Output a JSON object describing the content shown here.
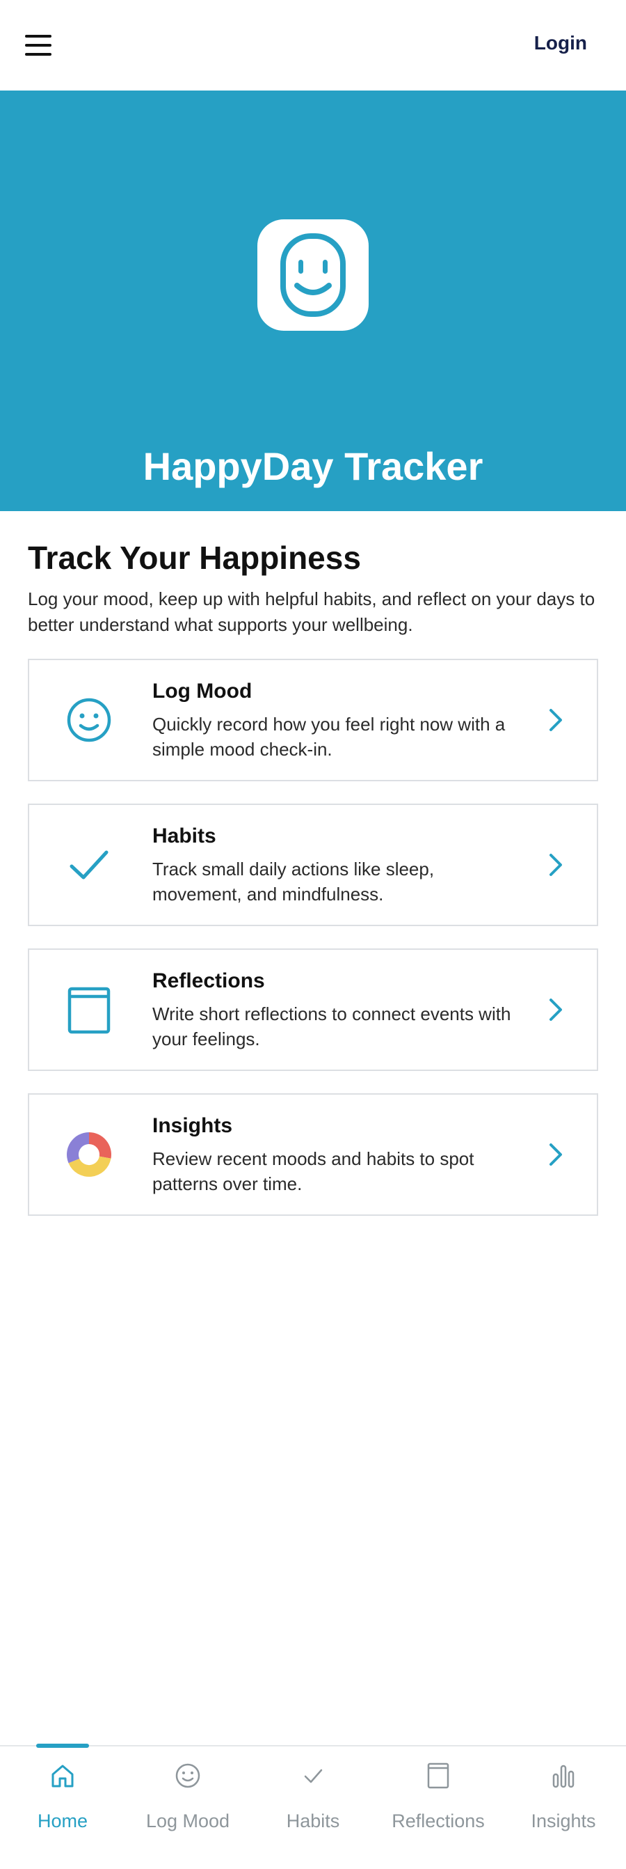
{
  "header": {
    "login_label": "Login"
  },
  "hero": {
    "title": "HappyDay Tracker",
    "background_color": "#26a0c4",
    "icon": "smile-face-icon"
  },
  "intro": {
    "title": "Track Your Happiness",
    "description": "Log your mood, keep up with helpful habits, and reflect on your days to better understand what supports your wellbeing."
  },
  "cards": [
    {
      "title": "Log Mood",
      "description": "Quickly record how you feel right now with a simple mood check-in.",
      "icon": "smile-icon"
    },
    {
      "title": "Habits",
      "description": "Track small daily actions like sleep, movement, and mindfulness.",
      "icon": "checkmark-icon"
    },
    {
      "title": "Reflections",
      "description": "Write short reflections to connect events with your feelings.",
      "icon": "journal-icon"
    },
    {
      "title": "Insights",
      "description": "Review recent moods and habits to spot patterns over time.",
      "icon": "donut-chart-icon"
    }
  ],
  "bottom_nav": {
    "items": [
      {
        "label": "Home",
        "icon": "home-icon",
        "active": true
      },
      {
        "label": "Log Mood",
        "icon": "smile-icon",
        "active": false
      },
      {
        "label": "Habits",
        "icon": "checkmark-icon",
        "active": false
      },
      {
        "label": "Reflections",
        "icon": "journal-icon",
        "active": false
      },
      {
        "label": "Insights",
        "icon": "bar-chart-icon",
        "active": false
      }
    ]
  },
  "colors": {
    "accent": "#26a0c4",
    "inactive": "#8e969b",
    "donut_purple": "#8a80d6",
    "donut_red": "#e9635a",
    "donut_yellow": "#f3cf56"
  }
}
